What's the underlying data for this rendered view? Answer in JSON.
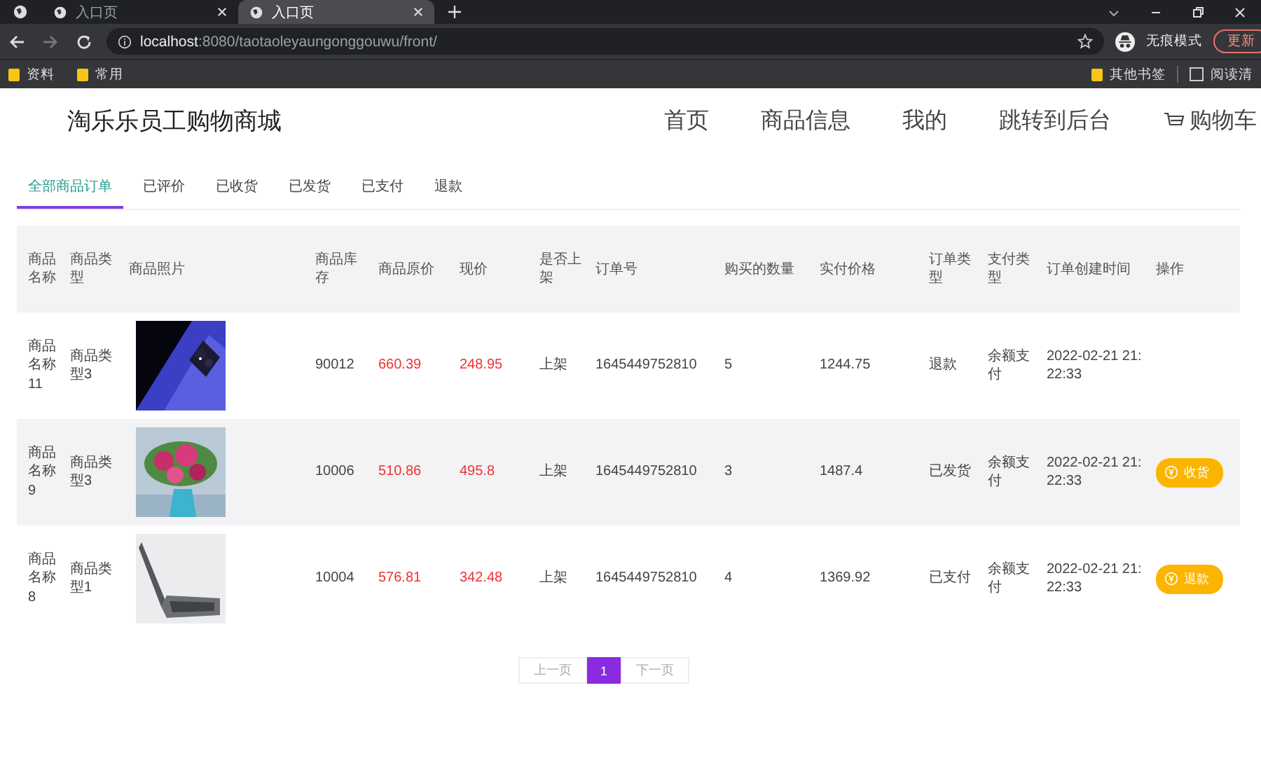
{
  "browser": {
    "tabs": [
      {
        "title": "入口页",
        "selected": false
      },
      {
        "title": "入口页",
        "selected": true
      }
    ],
    "address": {
      "host": "localhost",
      "path": ":8080/taotaoleyaungonggouwu/front/"
    },
    "profile": "无痕模式",
    "update_button": "更新",
    "bookmarks": [
      "资料",
      "常用"
    ],
    "bookmarks_right": [
      "其他书签",
      "阅读清"
    ]
  },
  "site": {
    "title": "淘乐乐员工购物商城",
    "nav": [
      {
        "label": "首页",
        "kind": "link"
      },
      {
        "label": "商品信息",
        "kind": "link"
      },
      {
        "label": "我的",
        "kind": "link"
      },
      {
        "label": "跳转到后台",
        "kind": "link"
      },
      {
        "label": "购物车",
        "kind": "cart"
      }
    ]
  },
  "order_tabs": [
    {
      "label": "全部商品订单",
      "selected": true
    },
    {
      "label": "已评价",
      "selected": false
    },
    {
      "label": "已收货",
      "selected": false
    },
    {
      "label": "已发货",
      "selected": false
    },
    {
      "label": "已支付",
      "selected": false
    },
    {
      "label": "退款",
      "selected": false
    }
  ],
  "table": {
    "columns": [
      "商品名称",
      "商品类型",
      "商品照片",
      "商品库存",
      "商品原价",
      "现价",
      "是否上架",
      "订单号",
      "购买的数量",
      "实付价格",
      "订单类型",
      "支付类型",
      "订单创建时间",
      "操作"
    ],
    "rows": [
      {
        "name": "商品名称11",
        "type": "商品类型3",
        "photo": {
          "kind": "phone"
        },
        "stock": "90012",
        "original_price": "660.39",
        "price": "248.95",
        "on_shelf": "上架",
        "order_no": "1645449752810",
        "quantity": "5",
        "paid": "1244.75",
        "order_type": "退款",
        "pay_type": "余额支付",
        "created": "2022-02-21 21:22:33",
        "highlighted": false
      },
      {
        "name": "商品名称9",
        "type": "商品类型3",
        "photo": {
          "kind": "flowers"
        },
        "stock": "10006",
        "original_price": "510.86",
        "price": "495.8",
        "on_shelf": "上架",
        "order_no": "1645449752810",
        "quantity": "3",
        "paid": "1487.4",
        "order_type": "已发货",
        "pay_type": "余额支付",
        "created": "2022-02-21 21:22:33",
        "action": "收货",
        "highlighted": true
      },
      {
        "name": "商品名称8",
        "type": "商品类型1",
        "photo": {
          "kind": "laptop"
        },
        "stock": "10004",
        "original_price": "576.81",
        "price": "342.48",
        "on_shelf": "上架",
        "order_no": "1645449752810",
        "quantity": "4",
        "paid": "1369.92",
        "order_type": "已支付",
        "pay_type": "余额支付",
        "created": "2022-02-21 21:22:33",
        "action": "退款",
        "highlighted": false
      }
    ]
  },
  "pagination": {
    "prev": "上一页",
    "pages": [
      {
        "label": "1",
        "selected": true
      }
    ],
    "next": "下一页"
  }
}
